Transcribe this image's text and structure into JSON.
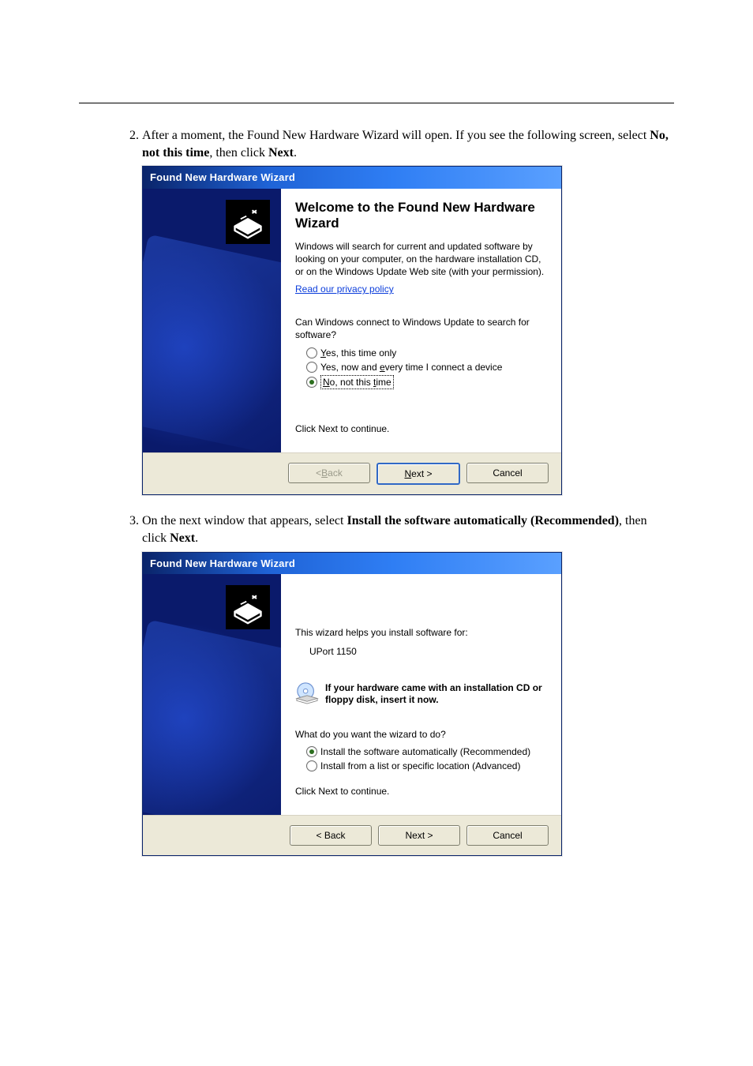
{
  "doc": {
    "step2_pre": "After a moment, the Found New Hardware Wizard will open. If you see the following screen, select ",
    "step2_bold": "No, not this time",
    "step2_mid": ", then click ",
    "step2_bold2": "Next",
    "step2_post": ".",
    "step3_pre": "On the next window that appears, select ",
    "step3_bold": "Install the software automatically (Recommended)",
    "step3_mid": ", then click ",
    "step3_bold2": "Next",
    "step3_post": "."
  },
  "dlg1": {
    "titlebar": "Found New Hardware Wizard",
    "heading": "Welcome to the Found New Hardware Wizard",
    "body1": "Windows will search for current and updated software by looking on your computer, on the hardware installation CD, or on the Windows Update Web site (with your permission).",
    "privacy_link": "Read our privacy policy",
    "prompt": "Can Windows connect to Windows Update to search for software?",
    "opt1_pre": "Y",
    "opt1_rest": "es, this time only",
    "opt2_pre": "Yes, now and ",
    "opt2_u": "e",
    "opt2_rest": "very time I connect a device",
    "opt3_pre": "N",
    "opt3_rest": "o, not this ",
    "opt3_u": "t",
    "opt3_rest2": "ime",
    "continue": "Click Next to continue.",
    "back_pre": "< ",
    "back_u": "B",
    "back_rest": "ack",
    "next_u": "N",
    "next_rest": "ext >",
    "cancel": "Cancel"
  },
  "dlg2": {
    "titlebar": "Found New Hardware Wizard",
    "body1": "This wizard helps you install software for:",
    "device": "UPort 1150",
    "cd_text": "If your hardware came with an installation CD or floppy disk, insert it now.",
    "prompt": "What do you want the wizard to do?",
    "opt1": "Install the software automatically (Recommended)",
    "opt2": "Install from a list or specific location (Advanced)",
    "continue": "Click Next to continue.",
    "back": "< Back",
    "next": "Next >",
    "cancel": "Cancel"
  }
}
